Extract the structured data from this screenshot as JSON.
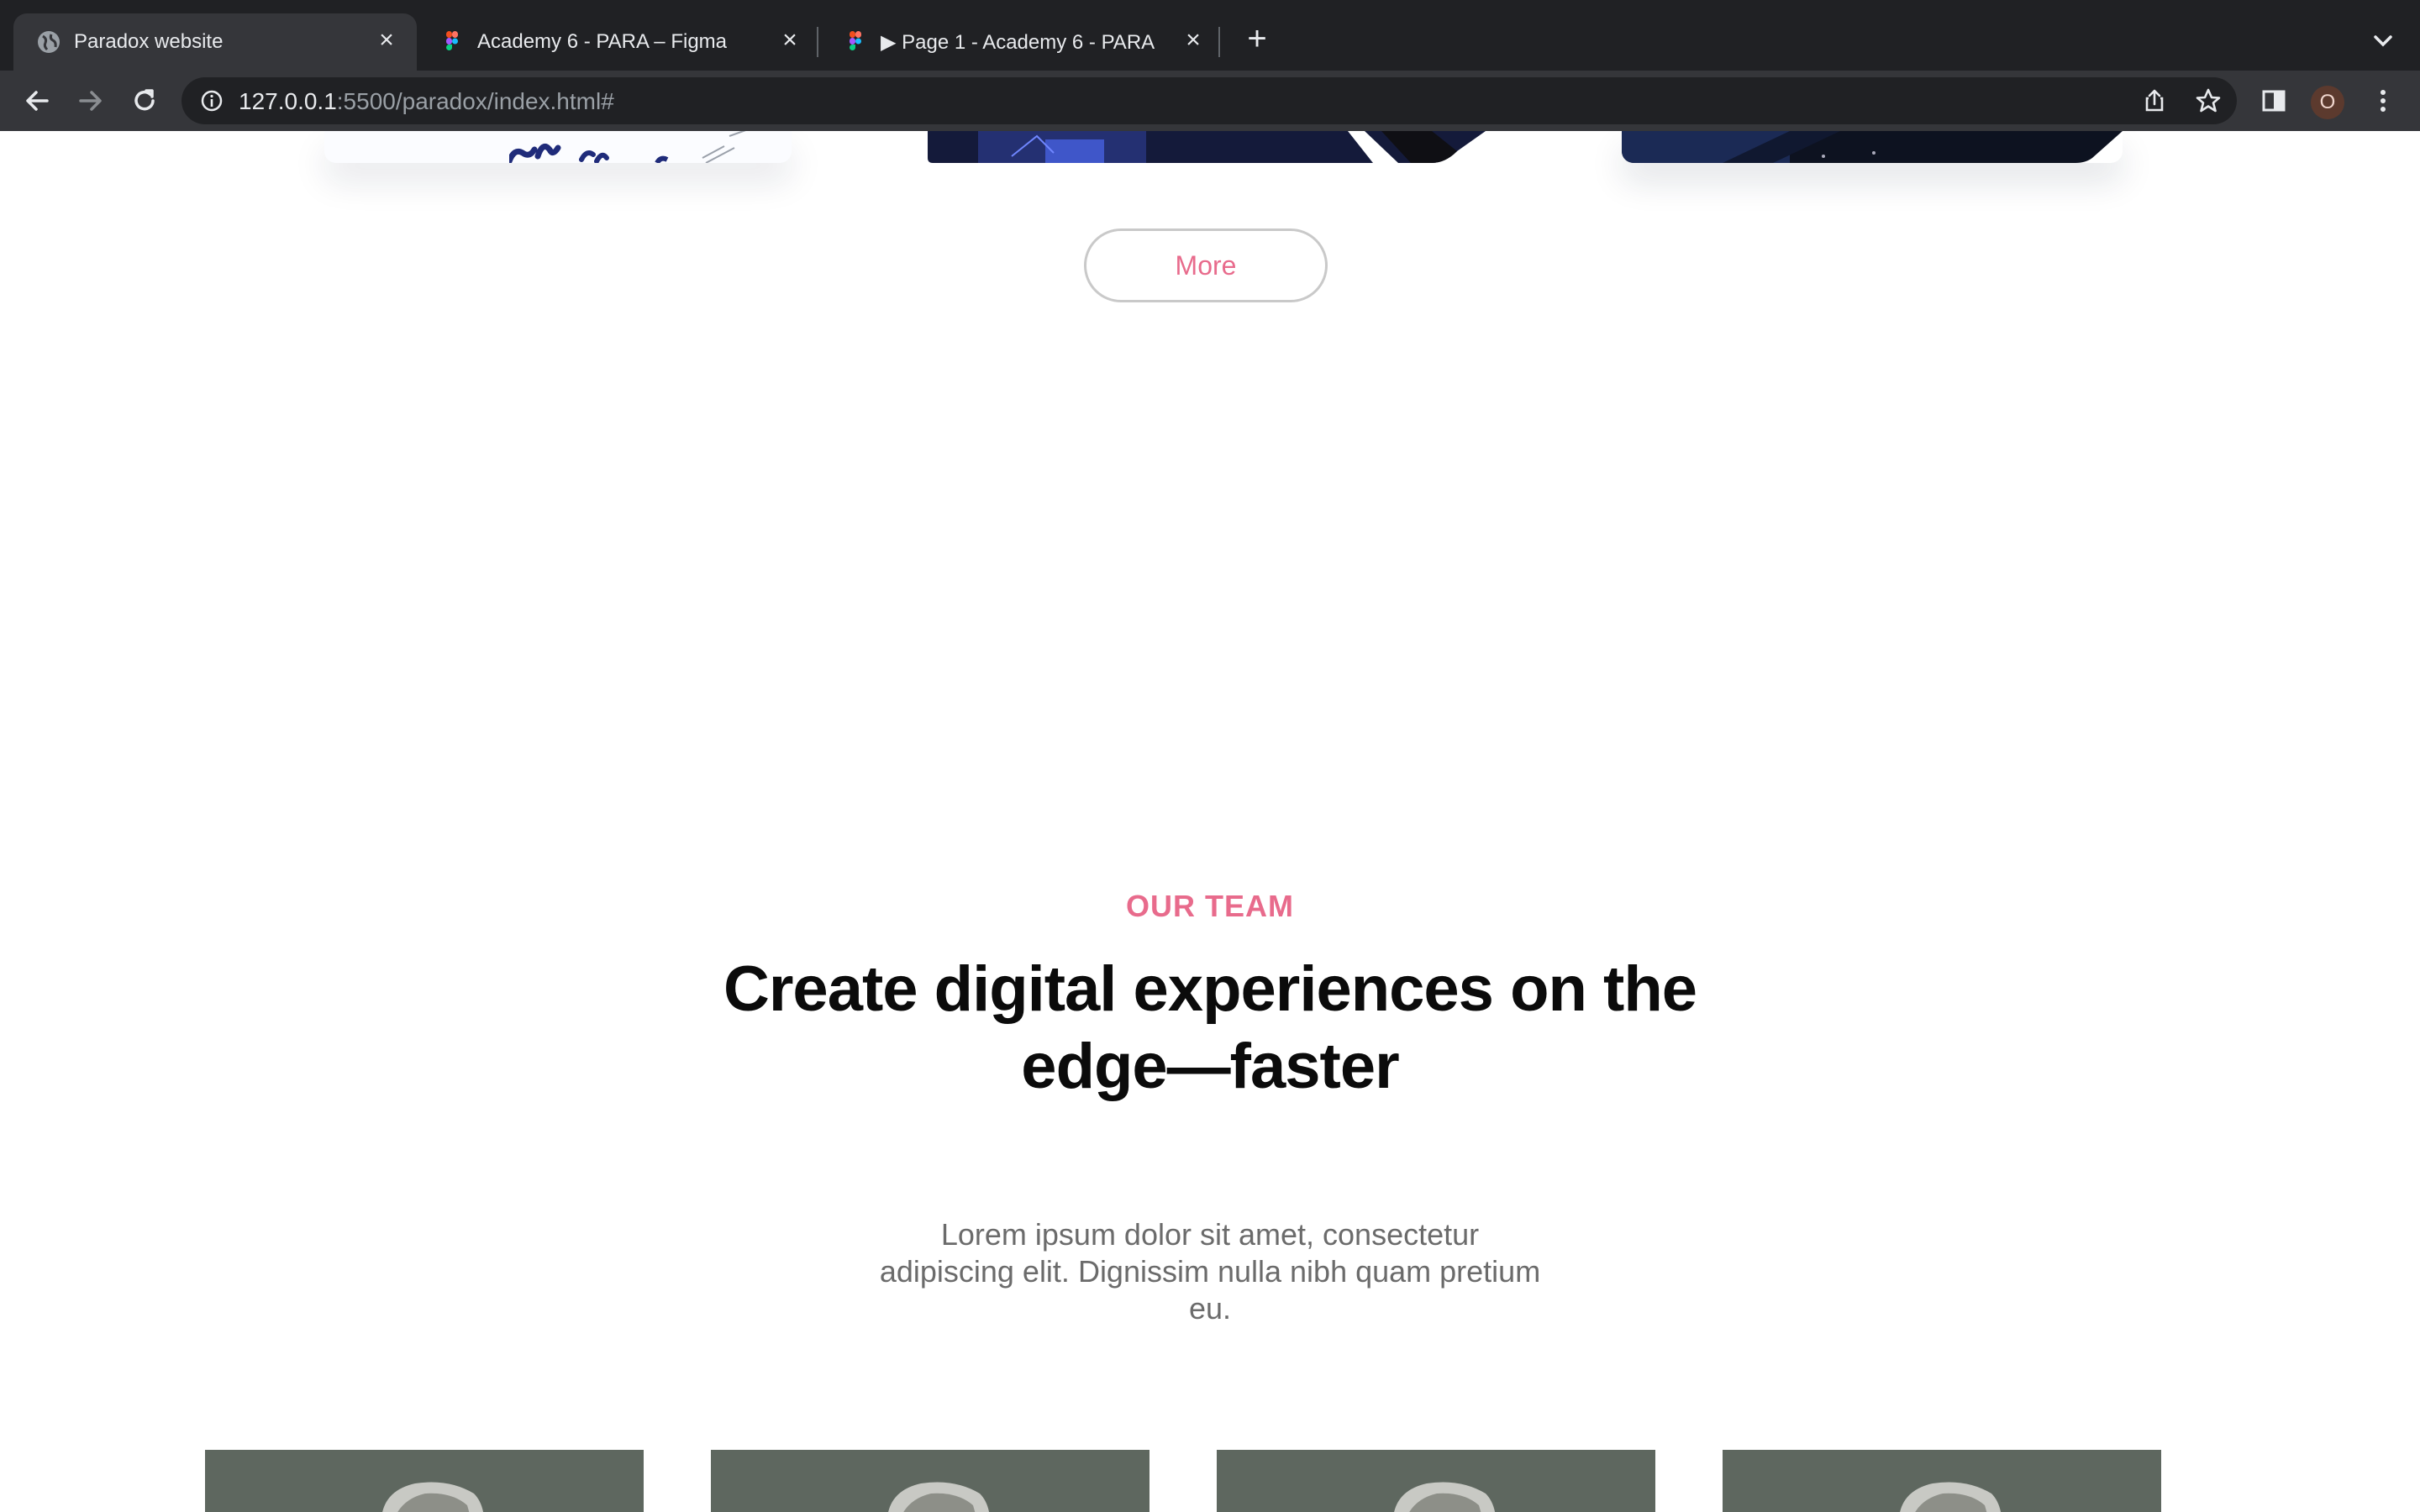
{
  "browser": {
    "tabs": [
      {
        "title": "Paradox website",
        "active": true,
        "icon": "globe-icon"
      },
      {
        "title": "Academy 6 - PARA – Figma",
        "active": false,
        "icon": "figma-icon"
      },
      {
        "title": "▶ Page 1 - Academy 6 - PARA",
        "active": false,
        "icon": "figma-icon"
      }
    ],
    "new_tab_label": "+",
    "close_glyph": "×",
    "url_host": "127.0.0.1",
    "url_rest": ":5500/paradox/index.html#",
    "profile_initial": "O"
  },
  "page": {
    "more_button": "More",
    "team": {
      "eyebrow": "OUR TEAM",
      "headline": "Create digital experiences on the edge—faster",
      "description": "Lorem ipsum dolor sit amet, consectetur adipiscing elit. Dignissim nulla nibh quam pretium eu."
    }
  },
  "colors": {
    "accent": "#e86b8c",
    "chrome_dark": "#202124",
    "chrome_toolbar": "#35363a"
  }
}
